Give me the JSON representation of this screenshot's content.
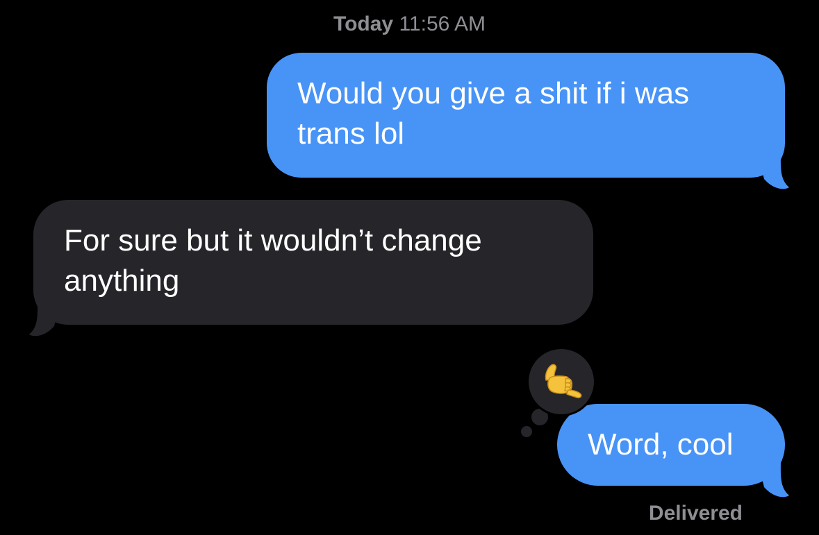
{
  "header": {
    "day": "Today",
    "time": "11:56 AM"
  },
  "messages": [
    {
      "direction": "outgoing",
      "lines": [
        "Would you give a shit if i was",
        "trans lol"
      ]
    },
    {
      "direction": "incoming",
      "lines": [
        "For sure but it wouldn’t change",
        "anything"
      ]
    },
    {
      "direction": "outgoing",
      "lines": [
        "Word, cool"
      ],
      "reaction": {
        "icon": "call-me-hand-icon",
        "glyph": "🤙"
      }
    }
  ],
  "status": {
    "label": "Delivered"
  },
  "colors": {
    "background": "#000000",
    "outgoing_bubble": "#4893f6",
    "incoming_bubble": "#26252a",
    "meta_text": "#8e8e93",
    "reaction_hand": "#f5c33b"
  }
}
